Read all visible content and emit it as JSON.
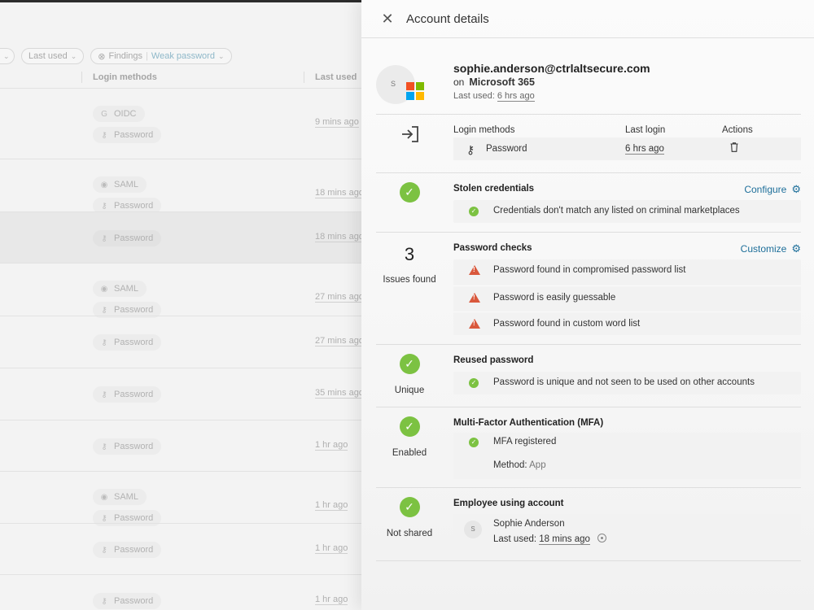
{
  "background": {
    "filters": {
      "last_used": "Last used",
      "findings": "Findings",
      "findings_value": "Weak password"
    },
    "columns": {
      "login_methods": "Login methods",
      "last_used": "Last used"
    },
    "rows": [
      {
        "methods": [
          {
            "icon": "G",
            "label": "OIDC"
          },
          {
            "icon": "key",
            "label": "Password"
          }
        ],
        "last_used": "9 mins ago"
      },
      {
        "methods": [
          {
            "icon": "saml",
            "label": "SAML"
          },
          {
            "icon": "key",
            "label": "Password"
          }
        ],
        "last_used": "18 mins ago"
      },
      {
        "methods": [
          {
            "icon": "key",
            "label": "Password"
          }
        ],
        "last_used": "18 mins ago"
      },
      {
        "methods": [
          {
            "icon": "saml",
            "label": "SAML"
          },
          {
            "icon": "key",
            "label": "Password"
          }
        ],
        "last_used": "27 mins ago"
      },
      {
        "methods": [
          {
            "icon": "key",
            "label": "Password"
          }
        ],
        "last_used": "27 mins ago"
      },
      {
        "methods": [
          {
            "icon": "key",
            "label": "Password"
          }
        ],
        "last_used": "35 mins ago"
      },
      {
        "methods": [
          {
            "icon": "key",
            "label": "Password"
          }
        ],
        "last_used": "1 hr ago"
      },
      {
        "methods": [
          {
            "icon": "saml",
            "label": "SAML"
          },
          {
            "icon": "key",
            "label": "Password"
          }
        ],
        "last_used": "1 hr ago"
      },
      {
        "methods": [
          {
            "icon": "key",
            "label": "Password"
          }
        ],
        "last_used": "1 hr ago"
      },
      {
        "methods": [
          {
            "icon": "key",
            "label": "Password"
          }
        ],
        "last_used": "1 hr ago"
      }
    ]
  },
  "panel": {
    "title": "Account details",
    "account": {
      "avatar_initial": "S",
      "email": "sophie.anderson@ctrlaltsecure.com",
      "on_label": "on",
      "app": "Microsoft 365",
      "last_used_label": "Last used:",
      "last_used_value": "6 hrs ago"
    },
    "login": {
      "methods_label": "Login methods",
      "last_login_label": "Last login",
      "actions_label": "Actions",
      "method": "Password",
      "last_login": "6 hrs ago"
    },
    "stolen": {
      "title": "Stolen credentials",
      "action": "Configure",
      "item": "Credentials don't match any listed on criminal marketplaces"
    },
    "password_checks": {
      "count": "3",
      "count_label": "Issues found",
      "title": "Password checks",
      "action": "Customize",
      "items": [
        "Password found in compromised password list",
        "Password is easily guessable",
        "Password found in custom word list"
      ]
    },
    "reused": {
      "status": "Unique",
      "title": "Reused password",
      "item": "Password is unique and not seen to be used on other accounts"
    },
    "mfa": {
      "status": "Enabled",
      "title": "Multi-Factor Authentication (MFA)",
      "item": "MFA registered",
      "method_label": "Method:",
      "method_value": "App"
    },
    "employee": {
      "status": "Not shared",
      "title": "Employee using account",
      "initial": "S",
      "name": "Sophie Anderson",
      "last_used_label": "Last used:",
      "last_used_value": "18 mins ago"
    }
  },
  "colors": {
    "ok": "#7cc242",
    "warn": "#d9583c",
    "link": "#1e6f9a"
  }
}
